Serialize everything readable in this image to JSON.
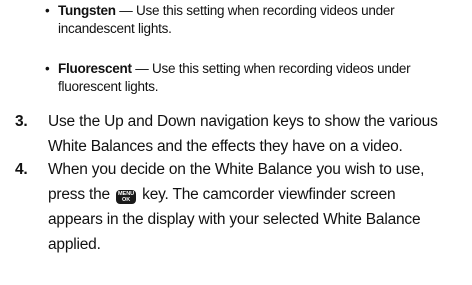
{
  "bullets": [
    {
      "term": "Tungsten",
      "line1": " — Use this setting when recording videos under",
      "line2": "incandescent lights."
    },
    {
      "term": "Fluorescent",
      "line1": " — Use this setting when recording videos under",
      "line2": "fluorescent lights."
    }
  ],
  "steps": [
    {
      "number": "3.",
      "lines": [
        "Use the Up and Down navigation keys to show the various",
        "White Balances and the effects they have on a video."
      ]
    },
    {
      "number": "4.",
      "line1": "When you decide on the White Balance you wish to use,",
      "line2_before": "press the ",
      "line2_after": " key. The camcorder viewfinder screen",
      "line3": "appears in the display with your selected White Balance",
      "line4": "applied."
    }
  ],
  "menu_key": {
    "top": "MENU",
    "bottom": "OK"
  }
}
